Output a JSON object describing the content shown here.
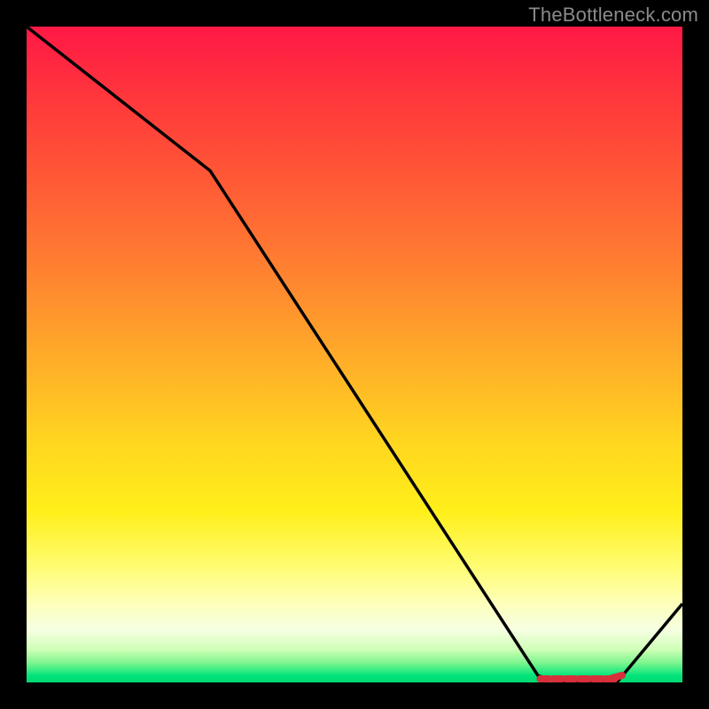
{
  "attribution": "TheBottleneck.com",
  "chart_data": {
    "type": "line",
    "title": "",
    "xlabel": "",
    "ylabel": "",
    "xlim": [
      0,
      100
    ],
    "ylim": [
      0,
      100
    ],
    "series": [
      {
        "name": "curve",
        "x": [
          0,
          28,
          78,
          82,
          90,
          100
        ],
        "values": [
          100,
          78,
          1,
          0,
          0,
          12
        ]
      }
    ],
    "flat_segment": {
      "x_start": 78,
      "x_end": 90,
      "y": 0
    },
    "annotations": [],
    "gradient_stops": [
      {
        "pos": 0.0,
        "color": "#ff1846"
      },
      {
        "pos": 0.5,
        "color": "#ffcc22"
      },
      {
        "pos": 0.9,
        "color": "#fdffbb"
      },
      {
        "pos": 1.0,
        "color": "#00d973"
      }
    ]
  }
}
